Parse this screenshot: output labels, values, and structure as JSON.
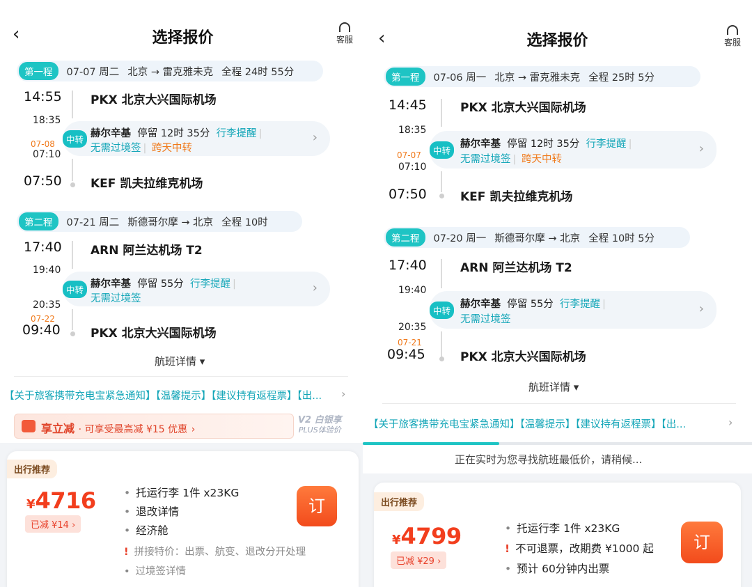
{
  "header": {
    "title": "选择报价",
    "back_icon": "chevron-left-icon",
    "service_label": "客服",
    "service_icon": "headset-icon"
  },
  "left": {
    "leg1": {
      "tag": "第一程",
      "date": "07-07 周二",
      "route": "北京 → 雷克雅未克",
      "duration": "全程 24时 55分",
      "dep_time": "14:55",
      "dep_airport": "PKX 北京大兴国际机场",
      "transfer_arr": "18:35",
      "transfer_dep_date": "07-08",
      "transfer_dep": "07:10",
      "transfer": {
        "tag": "中转",
        "city": "赫尔辛基",
        "stay": "停留 12时 35分",
        "baggage": "行李提醒",
        "visa": "无需过境签",
        "overnight": "跨天中转"
      },
      "arr_time": "07:50",
      "arr_airport": "KEF 凯夫拉维克机场"
    },
    "leg2": {
      "tag": "第二程",
      "date": "07-21 周二",
      "route": "斯德哥尔摩 → 北京",
      "duration": "全程 10时",
      "dep_time": "17:40",
      "dep_airport": "ARN 阿兰达机场 T2",
      "transfer_arr": "19:40",
      "transfer_dep": "20:35",
      "transfer": {
        "tag": "中转",
        "city": "赫尔辛基",
        "stay": "停留 55分",
        "baggage": "行李提醒",
        "visa": "无需过境签"
      },
      "arr_date": "07-22",
      "arr_time": "09:40",
      "arr_airport": "PKX 北京大兴国际机场"
    },
    "details_label": "航班详情",
    "notice": "【关于旅客携带充电宝紧急通知】【温馨提示】【建议持有返程票】【出...",
    "promo": {
      "title": "享立减",
      "text": "· 可享受最高减 ¥15 优惠",
      "plus_line1": "V2 白银享",
      "plus_line2": "PLUS体验价"
    },
    "offer": {
      "tag": "出行推荐",
      "currency": "¥",
      "price": "4716",
      "reduced": "已减 ¥14 ›",
      "features": [
        "托运行李 1件 x23KG",
        "退改详情",
        "经济舱"
      ],
      "note1": "拼接特价：出票、航变、退改分开处理",
      "note2": "过境签详情",
      "book": "订"
    }
  },
  "right": {
    "leg1": {
      "tag": "第一程",
      "date": "07-06 周一",
      "route": "北京 → 雷克雅未克",
      "duration": "全程 25时 5分",
      "dep_time": "14:45",
      "dep_airport": "PKX 北京大兴国际机场",
      "transfer_arr": "18:35",
      "transfer_dep_date": "07-07",
      "transfer_dep": "07:10",
      "transfer": {
        "tag": "中转",
        "city": "赫尔辛基",
        "stay": "停留 12时 35分",
        "baggage": "行李提醒",
        "visa": "无需过境签",
        "overnight": "跨天中转"
      },
      "arr_time": "07:50",
      "arr_airport": "KEF 凯夫拉维克机场"
    },
    "leg2": {
      "tag": "第二程",
      "date": "07-20 周一",
      "route": "斯德哥尔摩 → 北京",
      "duration": "全程 10时 5分",
      "dep_time": "17:40",
      "dep_airport": "ARN 阿兰达机场 T2",
      "transfer_arr": "19:40",
      "transfer_dep": "20:35",
      "transfer": {
        "tag": "中转",
        "city": "赫尔辛基",
        "stay": "停留 55分",
        "baggage": "行李提醒",
        "visa": "无需过境签"
      },
      "arr_date": "07-21",
      "arr_time": "09:45",
      "arr_airport": "PKX 北京大兴国际机场"
    },
    "details_label": "航班详情",
    "notice": "【关于旅客携带充电宝紧急通知】【温馨提示】【建议持有返程票】【出...",
    "searching": "正在实时为您寻找航班最低价，请稍候...",
    "search_progress": 0.35,
    "offer": {
      "tag": "出行推荐",
      "currency": "¥",
      "price": "4799",
      "reduced": "已减 ¥29 ›",
      "features": [
        "托运行李 1件 x23KG",
        "不可退票，改期费 ¥1000 起",
        "预计 60分钟内出票"
      ],
      "book": "订"
    }
  }
}
